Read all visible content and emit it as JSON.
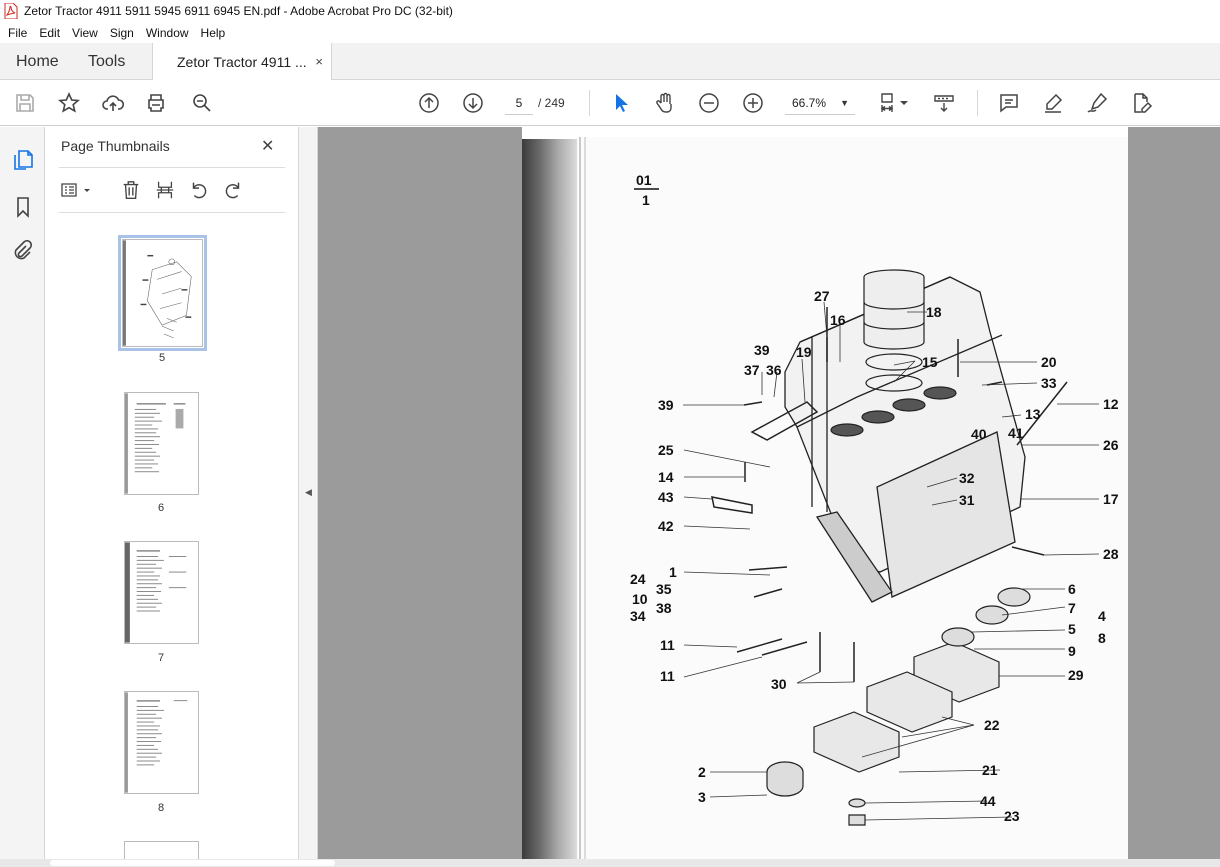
{
  "window": {
    "title": "Zetor Tractor 4911 5911 5945 6911 6945 EN.pdf - Adobe Acrobat Pro DC (32-bit)"
  },
  "menu": [
    "File",
    "Edit",
    "View",
    "Sign",
    "Window",
    "Help"
  ],
  "tabs": {
    "home": "Home",
    "tools": "Tools",
    "doc": "Zetor Tractor 4911 ...",
    "close": "×"
  },
  "toolbar": {
    "page_current": "5",
    "page_total": "/ 249",
    "zoom": "66.7%"
  },
  "thumbnails": {
    "title": "Page Thumbnails",
    "close": "✕",
    "pages": [
      "5",
      "6",
      "7",
      "8"
    ]
  },
  "diagram": {
    "header_top": "01",
    "header_bottom": "1",
    "callouts": [
      "27",
      "16",
      "18",
      "15",
      "39",
      "37",
      "36",
      "19",
      "20",
      "33",
      "39",
      "13",
      "12",
      "40",
      "41",
      "26",
      "25",
      "14",
      "32",
      "31",
      "17",
      "43",
      "42",
      "28",
      "1",
      "24",
      "35",
      "10",
      "38",
      "34",
      "6",
      "7",
      "4",
      "5",
      "8",
      "9",
      "11",
      "11",
      "30",
      "29",
      "22",
      "2",
      "3",
      "21",
      "44",
      "23"
    ]
  },
  "colors": {
    "accent": "#1473e6",
    "doc_bg": "#9b9b9b"
  }
}
